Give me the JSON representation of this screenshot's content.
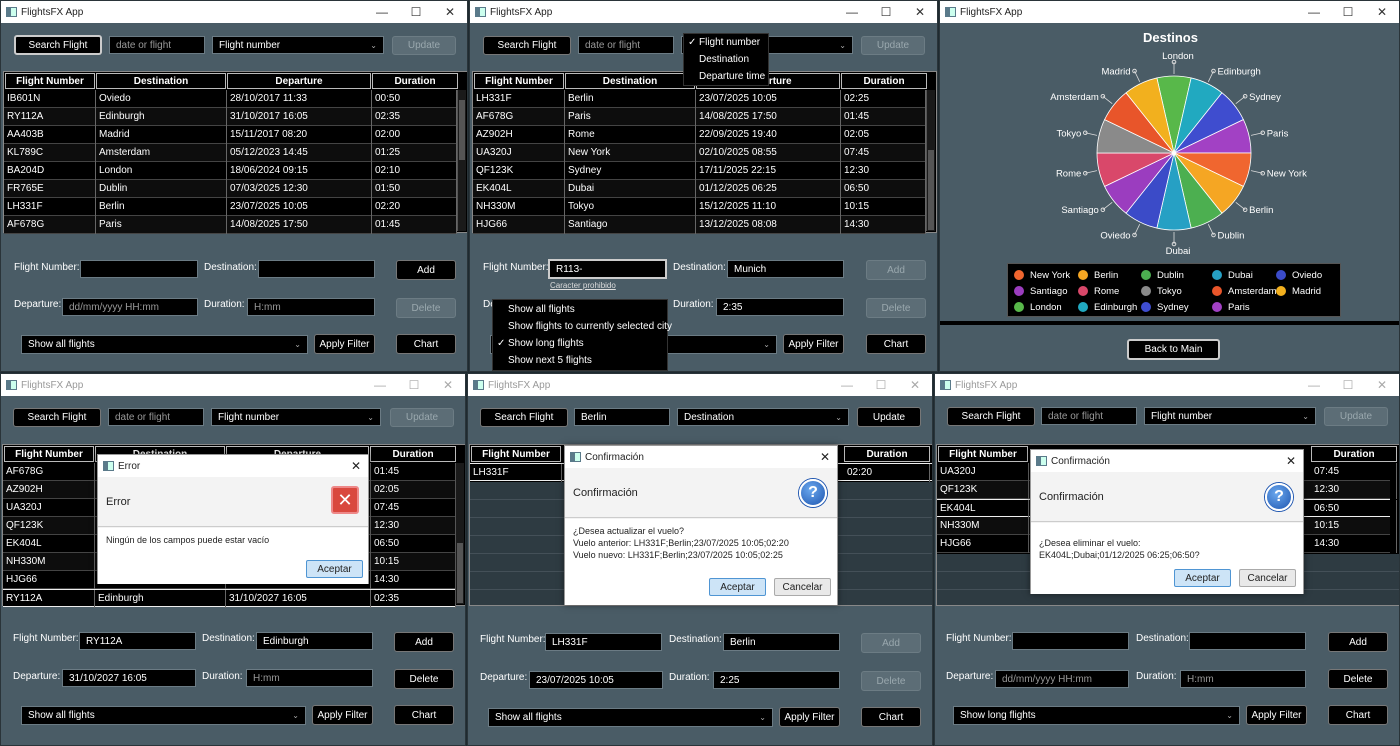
{
  "app_title": "FlightsFX App",
  "common": {
    "search_flight": "Search Flight",
    "date_or_flight_ph": "date or flight",
    "update": "Update",
    "flight_number_lbl": "Flight Number:",
    "destination_lbl": "Destination:",
    "departure_lbl": "Departure:",
    "duration_lbl": "Duration:",
    "add": "Add",
    "delete": "Delete",
    "apply_filter": "Apply Filter",
    "chart": "Chart",
    "date_ph": "dd/mm/yyyy HH:mm",
    "duration_ph": "H:mm",
    "col_flight": "Flight Number",
    "col_dest": "Destination",
    "col_dep": "Departure",
    "col_dur": "Duration"
  },
  "w1": {
    "combo": "Flight number",
    "filter": "Show all flights",
    "rows": [
      [
        "IB601N",
        "Oviedo",
        "28/10/2017 11:33",
        "00:50"
      ],
      [
        "RY112A",
        "Edinburgh",
        "31/10/2017 16:05",
        "02:35"
      ],
      [
        "AA403B",
        "Madrid",
        "15/11/2017 08:20",
        "02:00"
      ],
      [
        "KL789C",
        "Amsterdam",
        "05/12/2023 14:45",
        "01:25"
      ],
      [
        "BA204D",
        "London",
        "18/06/2024 09:15",
        "02:10"
      ],
      [
        "FR765E",
        "Dublin",
        "07/03/2025 12:30",
        "01:50"
      ],
      [
        "LH331F",
        "Berlin",
        "23/07/2025 10:05",
        "02:20"
      ],
      [
        "AF678G",
        "Paris",
        "14/08/2025 17:50",
        "01:45"
      ]
    ]
  },
  "w2": {
    "menu": [
      "Flight number",
      "Destination",
      "Departure time"
    ],
    "rows": [
      [
        "LH331F",
        "Berlin",
        "23/07/2025 10:05",
        "02:25"
      ],
      [
        "AF678G",
        "Paris",
        "14/08/2025 17:50",
        "01:45"
      ],
      [
        "AZ902H",
        "Rome",
        "22/09/2025 19:40",
        "02:05"
      ],
      [
        "UA320J",
        "New York",
        "02/10/2025 08:55",
        "07:45"
      ],
      [
        "QF123K",
        "Sydney",
        "17/11/2025 22:15",
        "12:30"
      ],
      [
        "EK404L",
        "Dubai",
        "01/12/2025 06:25",
        "06:50"
      ],
      [
        "NH330M",
        "Tokyo",
        "15/12/2025 11:10",
        "10:15"
      ],
      [
        "HJG66",
        "Santiago",
        "13/12/2025 08:08",
        "14:30"
      ]
    ],
    "fn_value": "R113-",
    "error_hint": "Caracter prohibido",
    "dest_value": "Munich",
    "dur_value": "2:35",
    "filter_menu": [
      "Show all flights",
      "Show flights to currently selected city",
      "Show long flights",
      "Show next 5 flights"
    ]
  },
  "w3": {
    "title": "Destinos",
    "back": "Back to Main",
    "legend": [
      {
        "name": "New York",
        "color": "#f0662f"
      },
      {
        "name": "Berlin",
        "color": "#f5a623"
      },
      {
        "name": "Dublin",
        "color": "#4caf50"
      },
      {
        "name": "Dubai",
        "color": "#26a0c4"
      },
      {
        "name": "Oviedo",
        "color": "#3b4bc8"
      },
      {
        "name": "Santiago",
        "color": "#9b3dbf"
      },
      {
        "name": "Rome",
        "color": "#d9486a"
      },
      {
        "name": "Tokyo",
        "color": "#8a8a8a"
      },
      {
        "name": "Amsterdam",
        "color": "#e8552a"
      },
      {
        "name": "Madrid",
        "color": "#f2b01e"
      },
      {
        "name": "London",
        "color": "#58b84a"
      },
      {
        "name": "Edinburgh",
        "color": "#21a9c0"
      },
      {
        "name": "Sydney",
        "color": "#3f4dcf"
      },
      {
        "name": "Paris",
        "color": "#a241c4"
      }
    ]
  },
  "chart_data": {
    "type": "pie",
    "title": "Destinos",
    "slices_clockwise_from_top": [
      "London",
      "Edinburgh",
      "Sydney",
      "Paris",
      "New York",
      "Berlin",
      "Dublin",
      "Dubai",
      "Oviedo",
      "Santiago",
      "Rome",
      "Tokyo",
      "Amsterdam",
      "Madrid"
    ],
    "values": [
      1,
      1,
      1,
      1,
      1,
      1,
      1,
      1,
      1,
      1,
      1,
      1,
      1,
      1
    ]
  },
  "w4": {
    "combo": "Flight number",
    "rows": [
      [
        "AF678G",
        "",
        "",
        " 01:45"
      ],
      [
        "AZ902H",
        "",
        "",
        "02:05"
      ],
      [
        "UA320J",
        "",
        "",
        "07:45"
      ],
      [
        "QF123K",
        "",
        "",
        "12:30"
      ],
      [
        "EK404L",
        "",
        "",
        "06:50"
      ],
      [
        "NH330M",
        "",
        "",
        "10:15"
      ],
      [
        "HJG66",
        "",
        "",
        "14:30"
      ],
      [
        "RY112A",
        "Edinburgh",
        "31/10/2027 16:05",
        "02:35"
      ]
    ],
    "dlg_title": "Error",
    "dlg_header": "Error",
    "dlg_body": "Ningún de los campos puede estar vacío",
    "accept": "Aceptar",
    "fn_value": "RY112A",
    "dest_value": "Edinburgh",
    "dep_value": "31/10/2027 16:05",
    "filter": "Show all flights"
  },
  "w5": {
    "search_value": "Berlin",
    "combo": "Destination",
    "row": [
      "LH331F",
      "02:20"
    ],
    "dlg_title": "Confirmación",
    "dlg_header": "Confirmación",
    "dlg_body1": "¿Desea actualizar el vuelo?",
    "dlg_body2": "Vuelo anterior: LH331F;Berlin;23/07/2025 10:05;02:20",
    "dlg_body3": "Vuelo nuevo: LH331F;Berlin;23/07/2025 10:05;02:25",
    "accept": "Aceptar",
    "cancel": "Cancelar",
    "fn_value": "LH331F",
    "dest_value": "Berlin",
    "dep_value": "23/07/2025 10:05",
    "dur_value": "2:25",
    "filter": "Show all flights"
  },
  "w6": {
    "combo": "Flight number",
    "rows": [
      [
        "UA320J",
        "07:45"
      ],
      [
        "QF123K",
        "12:30"
      ],
      [
        "EK404L",
        "06:50"
      ],
      [
        "NH330M",
        "10:15"
      ],
      [
        "HJG66",
        "14:30"
      ]
    ],
    "dlg_title": "Confirmación",
    "dlg_header": "Confirmación",
    "dlg_body1": "¿Desea eliminar el vuelo:",
    "dlg_body2": "EK404L;Dubai;01/12/2025 06:25;06:50?",
    "accept": "Aceptar",
    "cancel": "Cancelar",
    "filter": "Show long flights"
  }
}
